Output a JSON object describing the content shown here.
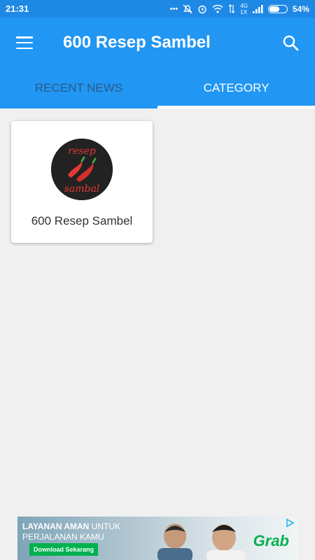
{
  "status_bar": {
    "time": "21:31",
    "network": "4G",
    "network_sub": "1X",
    "battery": "54%"
  },
  "app_bar": {
    "title": "600 Resep Sambel",
    "menu_icon": "hamburger-menu-icon",
    "search_icon": "search-icon"
  },
  "tabs": [
    {
      "label": "RECENT NEWS",
      "active": false
    },
    {
      "label": "CATEGORY",
      "active": true
    }
  ],
  "categories": [
    {
      "title": "600 Resep Sambel",
      "logo_text_top": "resep",
      "logo_text_bottom": "sambal"
    }
  ],
  "ad": {
    "headline_bold": "LAYANAN AMAN",
    "headline_rest": " UNTUK",
    "headline_line2": "PERJALANAN KAMU",
    "cta": "Download Sekarang",
    "brand": "Grab"
  },
  "colors": {
    "primary": "#2196f3",
    "status_bar": "#1e88e5",
    "background": "#f0f0f0",
    "inactive_tab": "#2a5b87",
    "ad_accent": "#00b14f"
  }
}
